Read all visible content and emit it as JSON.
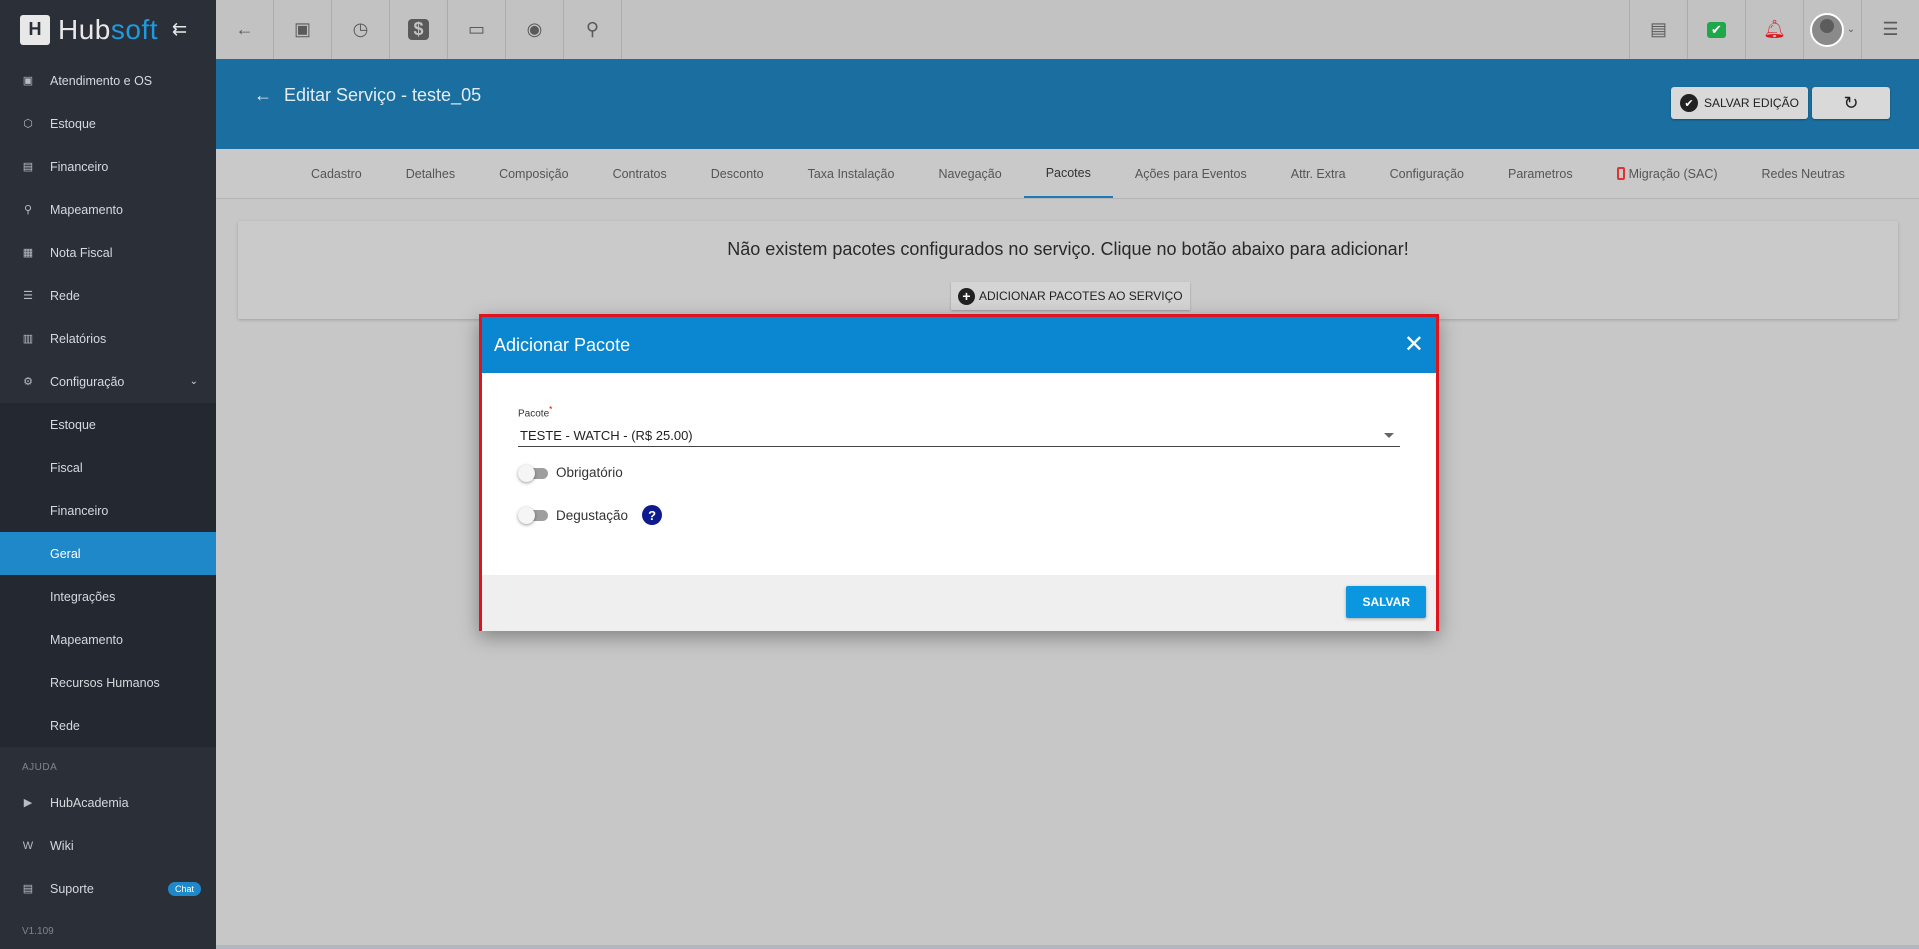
{
  "brand": {
    "name_prefix": "Hub",
    "name_suffix": "soft",
    "collapse_icon": "collapse-arrow-icon"
  },
  "topbar": {
    "left_icons": [
      "back-arrow-icon",
      "contact-card-icon",
      "calendar-clock-icon",
      "dollar-icon",
      "terminal-icon",
      "eye-icon",
      "search-icon"
    ],
    "right_icons": [
      "pdf-icon",
      "check-chat-icon",
      "alarm-bell-icon",
      "avatar",
      "menu-list-icon"
    ],
    "colors": {
      "check_chat": "#1fa84a",
      "alarm_bell": "#e0141c"
    }
  },
  "sidebar": {
    "items": [
      {
        "label": "Atendimento e OS"
      },
      {
        "label": "Estoque"
      },
      {
        "label": "Financeiro"
      },
      {
        "label": "Mapeamento"
      },
      {
        "label": "Nota Fiscal"
      },
      {
        "label": "Rede"
      },
      {
        "label": "Relatórios"
      },
      {
        "label": "Configuração"
      }
    ],
    "sub_items": [
      {
        "label": "Estoque"
      },
      {
        "label": "Fiscal"
      },
      {
        "label": "Financeiro"
      },
      {
        "label": "Geral"
      },
      {
        "label": "Integrações"
      },
      {
        "label": "Mapeamento"
      },
      {
        "label": "Recursos Humanos"
      },
      {
        "label": "Rede"
      }
    ],
    "help_section": "AJUDA",
    "help_items": [
      {
        "label": "HubAcademia"
      },
      {
        "label": "Wiki"
      },
      {
        "label": "Suporte",
        "badge": "Chat"
      }
    ],
    "version": "V1.109",
    "active_color": "#1e88c9"
  },
  "header": {
    "title": "Editar Serviço - teste_05",
    "save_label": "SALVAR EDIÇÃO",
    "bg_color": "#1a6fa0"
  },
  "tabs": [
    {
      "label": "Cadastro"
    },
    {
      "label": "Detalhes"
    },
    {
      "label": "Composição"
    },
    {
      "label": "Contratos"
    },
    {
      "label": "Desconto"
    },
    {
      "label": "Taxa Instalação"
    },
    {
      "label": "Navegação"
    },
    {
      "label": "Pacotes",
      "active": true
    },
    {
      "label": "Ações para Eventos"
    },
    {
      "label": "Attr. Extra"
    },
    {
      "label": "Configuração"
    },
    {
      "label": "Parametros"
    },
    {
      "label": "Migração (SAC)",
      "icon": "phone-icon"
    },
    {
      "label": "Redes Neutras"
    }
  ],
  "content": {
    "empty_message": "Não existem pacotes configurados no serviço. Clique no botão abaixo para adicionar!",
    "add_button_label": "ADICIONAR PACOTES AO SERVIÇO"
  },
  "modal": {
    "title": "Adicionar Pacote",
    "pacote_label": "Pacote",
    "pacote_required_mark": "*",
    "pacote_value": "TESTE - WATCH - (R$ 25.00)",
    "obrigatorio_label": "Obrigatório",
    "obrigatorio_on": false,
    "degustacao_label": "Degustação",
    "degustacao_on": false,
    "help_glyph": "?",
    "save_label": "SALVAR",
    "header_color": "#0a87d0",
    "highlight_border_color": "#e0141c"
  }
}
